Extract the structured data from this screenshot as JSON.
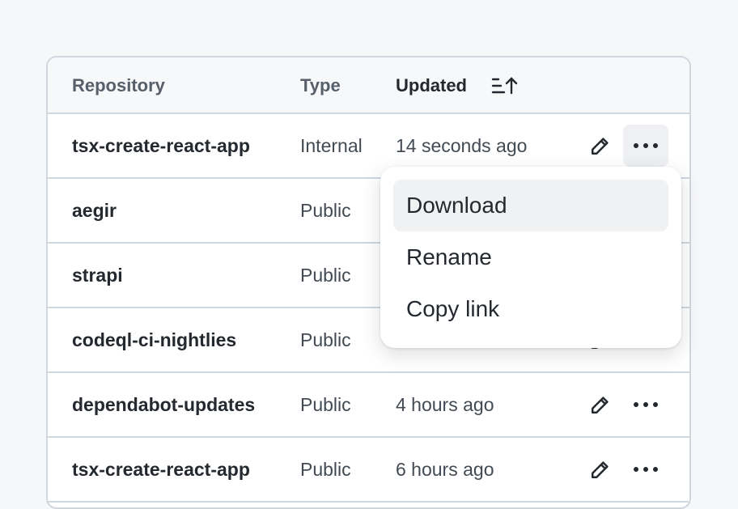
{
  "table": {
    "headers": {
      "repository": "Repository",
      "type": "Type",
      "updated": "Updated"
    },
    "sort_icon": "sort-ascending-icon",
    "rows": [
      {
        "name": "tsx-create-react-app",
        "type": "Internal",
        "updated": "14 seconds ago"
      },
      {
        "name": "aegir",
        "type": "Public",
        "updated": ""
      },
      {
        "name": "strapi",
        "type": "Public",
        "updated": ""
      },
      {
        "name": "codeql-ci-nightlies",
        "type": "Public",
        "updated": ""
      },
      {
        "name": "dependabot-updates",
        "type": "Public",
        "updated": "4 hours ago"
      },
      {
        "name": "tsx-create-react-app",
        "type": "Public",
        "updated": "6 hours ago"
      }
    ],
    "row_icons": {
      "edit": "pencil-icon",
      "more": "kebab-horizontal-icon"
    }
  },
  "menu": {
    "items": [
      {
        "label": "Download",
        "highlighted": true
      },
      {
        "label": "Rename",
        "highlighted": false
      },
      {
        "label": "Copy link",
        "highlighted": false
      }
    ]
  },
  "colors": {
    "background": "#f6f7f9",
    "border": "#d0d7de",
    "header_bg": "#f6f8fa",
    "text_primary": "#24292f",
    "text_muted": "#57606a",
    "menu_hover": "#f0f1f3"
  }
}
